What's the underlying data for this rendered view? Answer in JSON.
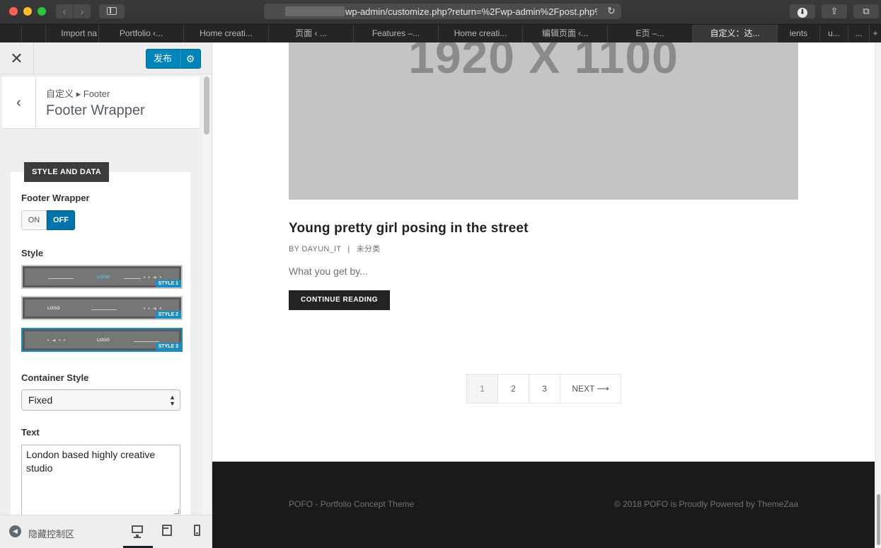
{
  "browser": {
    "url": "wp-admin/customize.php?return=%2Fwp-admin%2Fpost.php%",
    "tabs": [
      {
        "label": ""
      },
      {
        "label": "Import na"
      },
      {
        "label": "Portfolio ‹..."
      },
      {
        "label": "Home creati..."
      },
      {
        "label": "页面 ‹ ..."
      },
      {
        "label": "Features –..."
      },
      {
        "label": "Home creati..."
      },
      {
        "label": "编辑页面 ‹..."
      },
      {
        "label": "E页 –..."
      },
      {
        "label": "自定义：达..."
      },
      {
        "label": "ients"
      },
      {
        "label": "u..."
      },
      {
        "label": "..."
      },
      {
        "label": "+"
      }
    ],
    "active_tab_index": 9,
    "icons": {
      "back": "chevron-left-icon",
      "forward": "chevron-right-icon",
      "sidebar": "sidebar-icon",
      "reload": "reload-icon",
      "download": "download-icon",
      "share": "share-icon",
      "tabs": "tabs-overview-icon"
    }
  },
  "customizer": {
    "publish_label": "发布",
    "breadcrumb": "自定义 ▸ Footer",
    "section_title": "Footer Wrapper",
    "panel_tab": "STYLE AND DATA",
    "footer_wrapper_label": "Footer Wrapper",
    "toggle": {
      "on": "ON",
      "off": "OFF",
      "selected": "OFF"
    },
    "style_label": "Style",
    "styles": [
      {
        "badge": "STYLE 1",
        "logo": "LOGO",
        "selected": false
      },
      {
        "badge": "STYLE 2",
        "logo": "LOGO",
        "selected": false
      },
      {
        "badge": "STYLE 3",
        "logo": "LOGO",
        "selected": true
      }
    ],
    "container_style_label": "Container Style",
    "container_style_value": "Fixed",
    "text_label": "Text",
    "text_value": "London based highly creative studio",
    "hide_controls_label": "隐藏控制区",
    "devices": [
      "desktop",
      "tablet",
      "mobile"
    ],
    "active_device": "desktop"
  },
  "preview": {
    "hero_text": "1920 X 1100",
    "post_title": "Young pretty girl posing in the street",
    "meta_author": "BY DAYUN_IT",
    "meta_sep": "|",
    "meta_category": "未分类",
    "excerpt": "What you get by...",
    "continue_label": "CONTINUE READING",
    "pagination": {
      "pages": [
        "1",
        "2",
        "3"
      ],
      "current": "1",
      "next": "NEXT"
    },
    "footer_left": "POFO - Portfolio Concept Theme",
    "footer_right": "© 2018 POFO is Proudly Powered by  ThemeZaa"
  },
  "colors": {
    "accent": "#0085ba",
    "toggle_active": "#0073aa",
    "footer_bg": "#1a1a1a"
  }
}
